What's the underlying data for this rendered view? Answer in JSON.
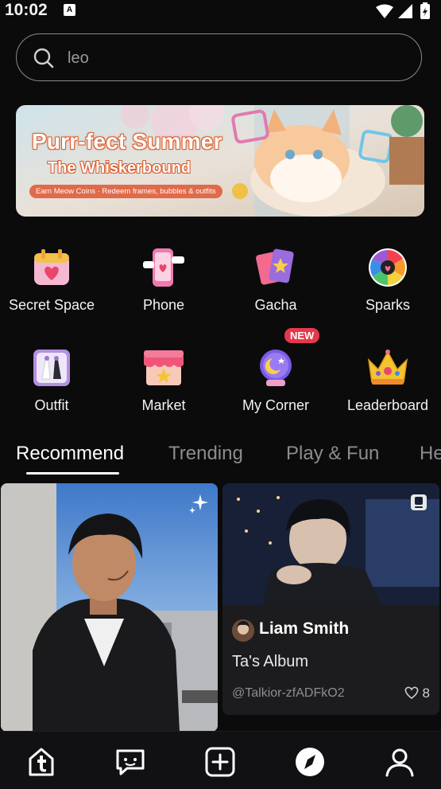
{
  "status": {
    "time": "10:02",
    "badge": "A"
  },
  "search": {
    "value": "leo"
  },
  "banner": {
    "title": "Purr-fect Summer",
    "subtitle": "The Whiskerbound",
    "caption": "Earn Meow Coins · Redeem frames, bubbles & outfits"
  },
  "features": [
    {
      "label": "Secret Space",
      "icon": "calendar-heart-icon"
    },
    {
      "label": "Phone",
      "icon": "phone-icon"
    },
    {
      "label": "Gacha",
      "icon": "cards-icon"
    },
    {
      "label": "Sparks",
      "icon": "sparks-wheel-icon"
    },
    {
      "label": "Outfit",
      "icon": "outfit-icon"
    },
    {
      "label": "Market",
      "icon": "market-icon"
    },
    {
      "label": "My Corner",
      "icon": "crystal-ball-icon",
      "badge": "NEW"
    },
    {
      "label": "Leaderboard",
      "icon": "crown-icon"
    }
  ],
  "tabs": [
    "Recommend",
    "Trending",
    "Play & Fun",
    "He"
  ],
  "active_tab": "Recommend",
  "cards": [
    {
      "type": "character",
      "icon": "sparkle-icon"
    },
    {
      "type": "album",
      "name": "Liam Smith",
      "title": "Ta's Album",
      "handle": "@Talkior-zfADFkO2",
      "likes": "8",
      "icon": "album-icon"
    }
  ],
  "nav": [
    "home",
    "chat",
    "create",
    "explore",
    "profile"
  ],
  "colors": {
    "background": "#0b0b0c",
    "accent": "#e5384c",
    "card": "#1c1c1e"
  }
}
